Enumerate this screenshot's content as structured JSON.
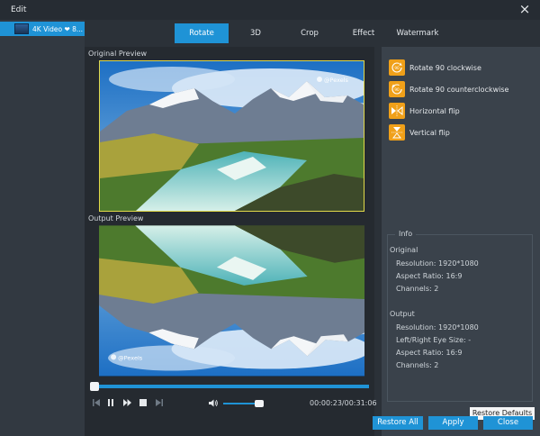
{
  "window": {
    "title": "Edit",
    "close_symbol": "×"
  },
  "sidebar": {
    "items": [
      {
        "label": "4K Video ❤ 8..."
      }
    ]
  },
  "tabs": [
    {
      "label": "Rotate",
      "active": true
    },
    {
      "label": "3D",
      "active": false
    },
    {
      "label": "Crop",
      "active": false
    },
    {
      "label": "Effect",
      "active": false
    },
    {
      "label": "Watermark",
      "active": false
    }
  ],
  "preview": {
    "original_label": "Original Preview",
    "output_label": "Output Preview",
    "watermark_text": "@Pexels",
    "progress_fraction": 0.0,
    "volume_fraction": 0.9,
    "timecode": "00:00:23/00:31:06"
  },
  "actions": [
    {
      "label": "Rotate 90 clockwise",
      "icon": "rotate-clockwise-icon"
    },
    {
      "label": "Rotate 90 counterclockwise",
      "icon": "rotate-counterclockwise-icon"
    },
    {
      "label": "Horizontal flip",
      "icon": "horizontal-flip-icon"
    },
    {
      "label": "Vertical flip",
      "icon": "vertical-flip-icon"
    }
  ],
  "info": {
    "title": "Info",
    "original_heading": "Original",
    "original": {
      "resolution": "Resolution: 1920*1080",
      "aspect": "Aspect Ratio: 16:9",
      "channels": "Channels: 2"
    },
    "output_heading": "Output",
    "output": {
      "resolution": "Resolution: 1920*1080",
      "eye_size": "Left/Right Eye Size: -",
      "aspect": "Aspect Ratio: 16:9",
      "channels": "Channels: 2"
    }
  },
  "buttons": {
    "restore_defaults": "Restore Defaults",
    "restore_all": "Restore All",
    "apply": "Apply",
    "close": "Close"
  },
  "colors": {
    "accent": "#1f93d6",
    "icon_orange": "#f0a019",
    "selection_outline": "#e2d94a"
  }
}
